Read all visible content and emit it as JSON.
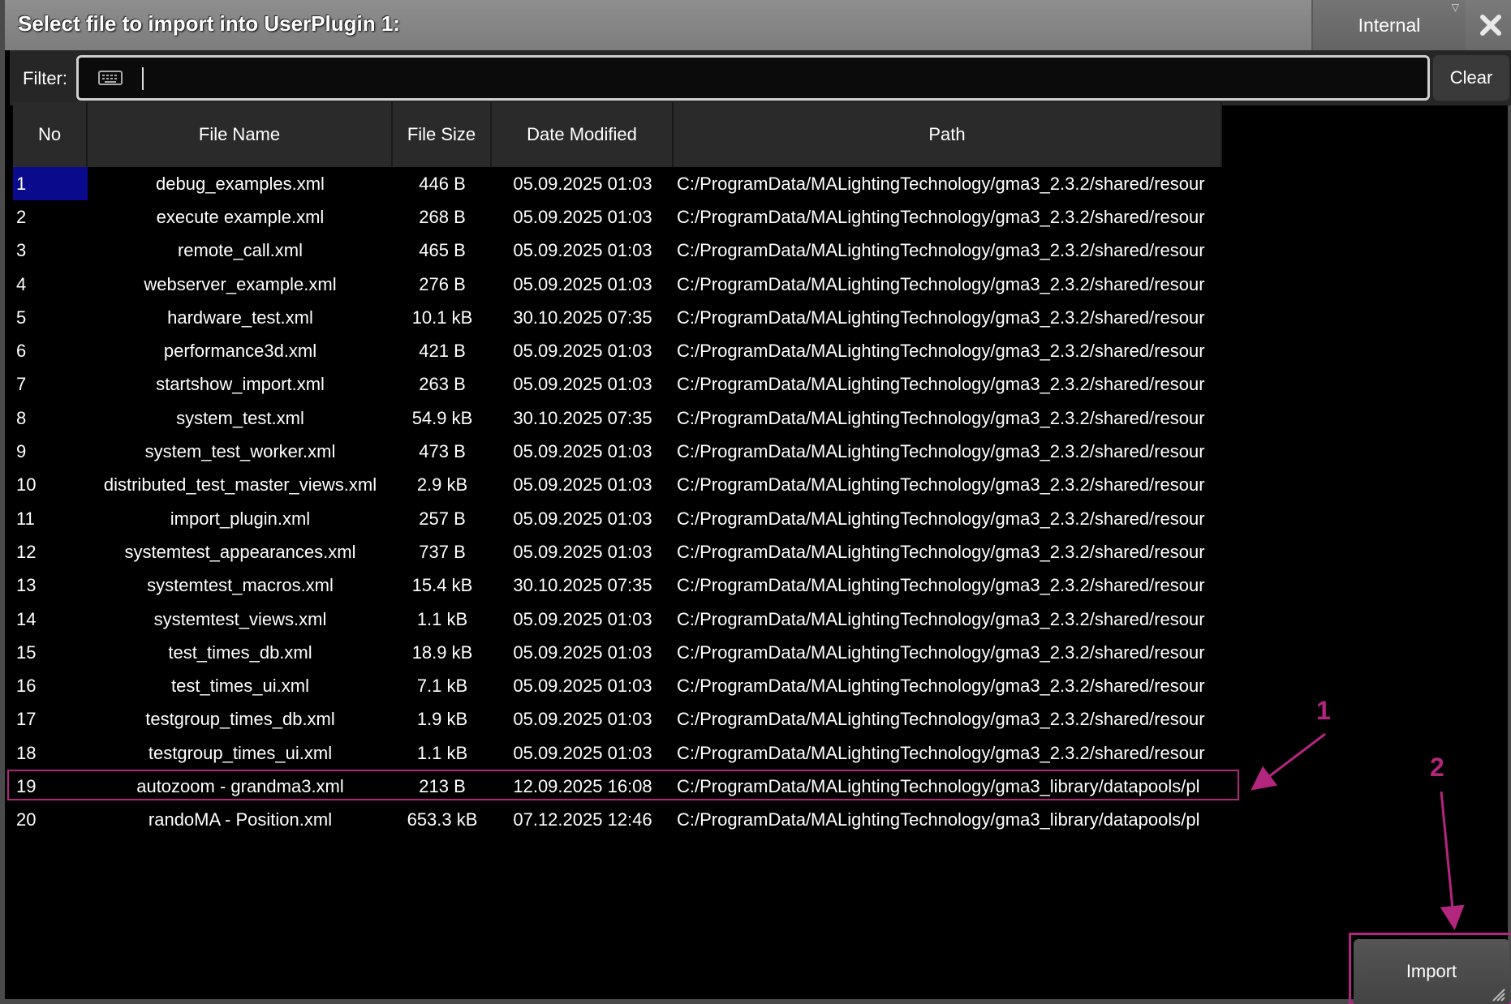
{
  "title": "Select file to import into UserPlugin 1:",
  "location_button": {
    "label": "Internal",
    "caret_icon": "caret-down-icon"
  },
  "close_icon": "close-icon",
  "filter": {
    "label": "Filter:",
    "value": "",
    "keyboard_icon": "keyboard-icon",
    "clear_label": "Clear"
  },
  "table": {
    "columns": [
      "No",
      "File Name",
      "File Size",
      "Date Modified",
      "Path"
    ],
    "rows": [
      {
        "no": "1",
        "name": "debug_examples.xml",
        "size": "446 B",
        "date": "05.09.2025 01:03",
        "path": "C:/ProgramData/MALightingTechnology/gma3_2.3.2/shared/resour"
      },
      {
        "no": "2",
        "name": "execute example.xml",
        "size": "268 B",
        "date": "05.09.2025 01:03",
        "path": "C:/ProgramData/MALightingTechnology/gma3_2.3.2/shared/resour"
      },
      {
        "no": "3",
        "name": "remote_call.xml",
        "size": "465 B",
        "date": "05.09.2025 01:03",
        "path": "C:/ProgramData/MALightingTechnology/gma3_2.3.2/shared/resour"
      },
      {
        "no": "4",
        "name": "webserver_example.xml",
        "size": "276 B",
        "date": "05.09.2025 01:03",
        "path": "C:/ProgramData/MALightingTechnology/gma3_2.3.2/shared/resour"
      },
      {
        "no": "5",
        "name": "hardware_test.xml",
        "size": "10.1 kB",
        "date": "30.10.2025 07:35",
        "path": "C:/ProgramData/MALightingTechnology/gma3_2.3.2/shared/resour"
      },
      {
        "no": "6",
        "name": "performance3d.xml",
        "size": "421 B",
        "date": "05.09.2025 01:03",
        "path": "C:/ProgramData/MALightingTechnology/gma3_2.3.2/shared/resour"
      },
      {
        "no": "7",
        "name": "startshow_import.xml",
        "size": "263 B",
        "date": "05.09.2025 01:03",
        "path": "C:/ProgramData/MALightingTechnology/gma3_2.3.2/shared/resour"
      },
      {
        "no": "8",
        "name": "system_test.xml",
        "size": "54.9 kB",
        "date": "30.10.2025 07:35",
        "path": "C:/ProgramData/MALightingTechnology/gma3_2.3.2/shared/resour"
      },
      {
        "no": "9",
        "name": "system_test_worker.xml",
        "size": "473 B",
        "date": "05.09.2025 01:03",
        "path": "C:/ProgramData/MALightingTechnology/gma3_2.3.2/shared/resour"
      },
      {
        "no": "10",
        "name": "distributed_test_master_views.xml",
        "size": "2.9 kB",
        "date": "05.09.2025 01:03",
        "path": "C:/ProgramData/MALightingTechnology/gma3_2.3.2/shared/resour"
      },
      {
        "no": "11",
        "name": "import_plugin.xml",
        "size": "257 B",
        "date": "05.09.2025 01:03",
        "path": "C:/ProgramData/MALightingTechnology/gma3_2.3.2/shared/resour"
      },
      {
        "no": "12",
        "name": "systemtest_appearances.xml",
        "size": "737 B",
        "date": "05.09.2025 01:03",
        "path": "C:/ProgramData/MALightingTechnology/gma3_2.3.2/shared/resour"
      },
      {
        "no": "13",
        "name": "systemtest_macros.xml",
        "size": "15.4 kB",
        "date": "30.10.2025 07:35",
        "path": "C:/ProgramData/MALightingTechnology/gma3_2.3.2/shared/resour"
      },
      {
        "no": "14",
        "name": "systemtest_views.xml",
        "size": "1.1 kB",
        "date": "05.09.2025 01:03",
        "path": "C:/ProgramData/MALightingTechnology/gma3_2.3.2/shared/resour"
      },
      {
        "no": "15",
        "name": "test_times_db.xml",
        "size": "18.9 kB",
        "date": "05.09.2025 01:03",
        "path": "C:/ProgramData/MALightingTechnology/gma3_2.3.2/shared/resour"
      },
      {
        "no": "16",
        "name": "test_times_ui.xml",
        "size": "7.1 kB",
        "date": "05.09.2025 01:03",
        "path": "C:/ProgramData/MALightingTechnology/gma3_2.3.2/shared/resour"
      },
      {
        "no": "17",
        "name": "testgroup_times_db.xml",
        "size": "1.9 kB",
        "date": "05.09.2025 01:03",
        "path": "C:/ProgramData/MALightingTechnology/gma3_2.3.2/shared/resour"
      },
      {
        "no": "18",
        "name": "testgroup_times_ui.xml",
        "size": "1.1 kB",
        "date": "05.09.2025 01:03",
        "path": "C:/ProgramData/MALightingTechnology/gma3_2.3.2/shared/resour"
      },
      {
        "no": "19",
        "name": "autozoom - grandma3.xml",
        "size": "213 B",
        "date": "12.09.2025 16:08",
        "path": "C:/ProgramData/MALightingTechnology/gma3_library/datapools/pl"
      },
      {
        "no": "20",
        "name": "randoMA - Position.xml",
        "size": "653.3 kB",
        "date": "07.12.2025 12:46",
        "path": "C:/ProgramData/MALightingTechnology/gma3_library/datapools/pl"
      }
    ],
    "selected_row": 1,
    "highlighted_row": 19
  },
  "annotations": {
    "marker_1": "1",
    "marker_2": "2",
    "color": "#b3267d"
  },
  "import_button": {
    "label": "Import"
  },
  "colors": {
    "title_bar": "#8e8e8e",
    "selection": "#0a0a8c",
    "header": "#2a2a2a"
  }
}
